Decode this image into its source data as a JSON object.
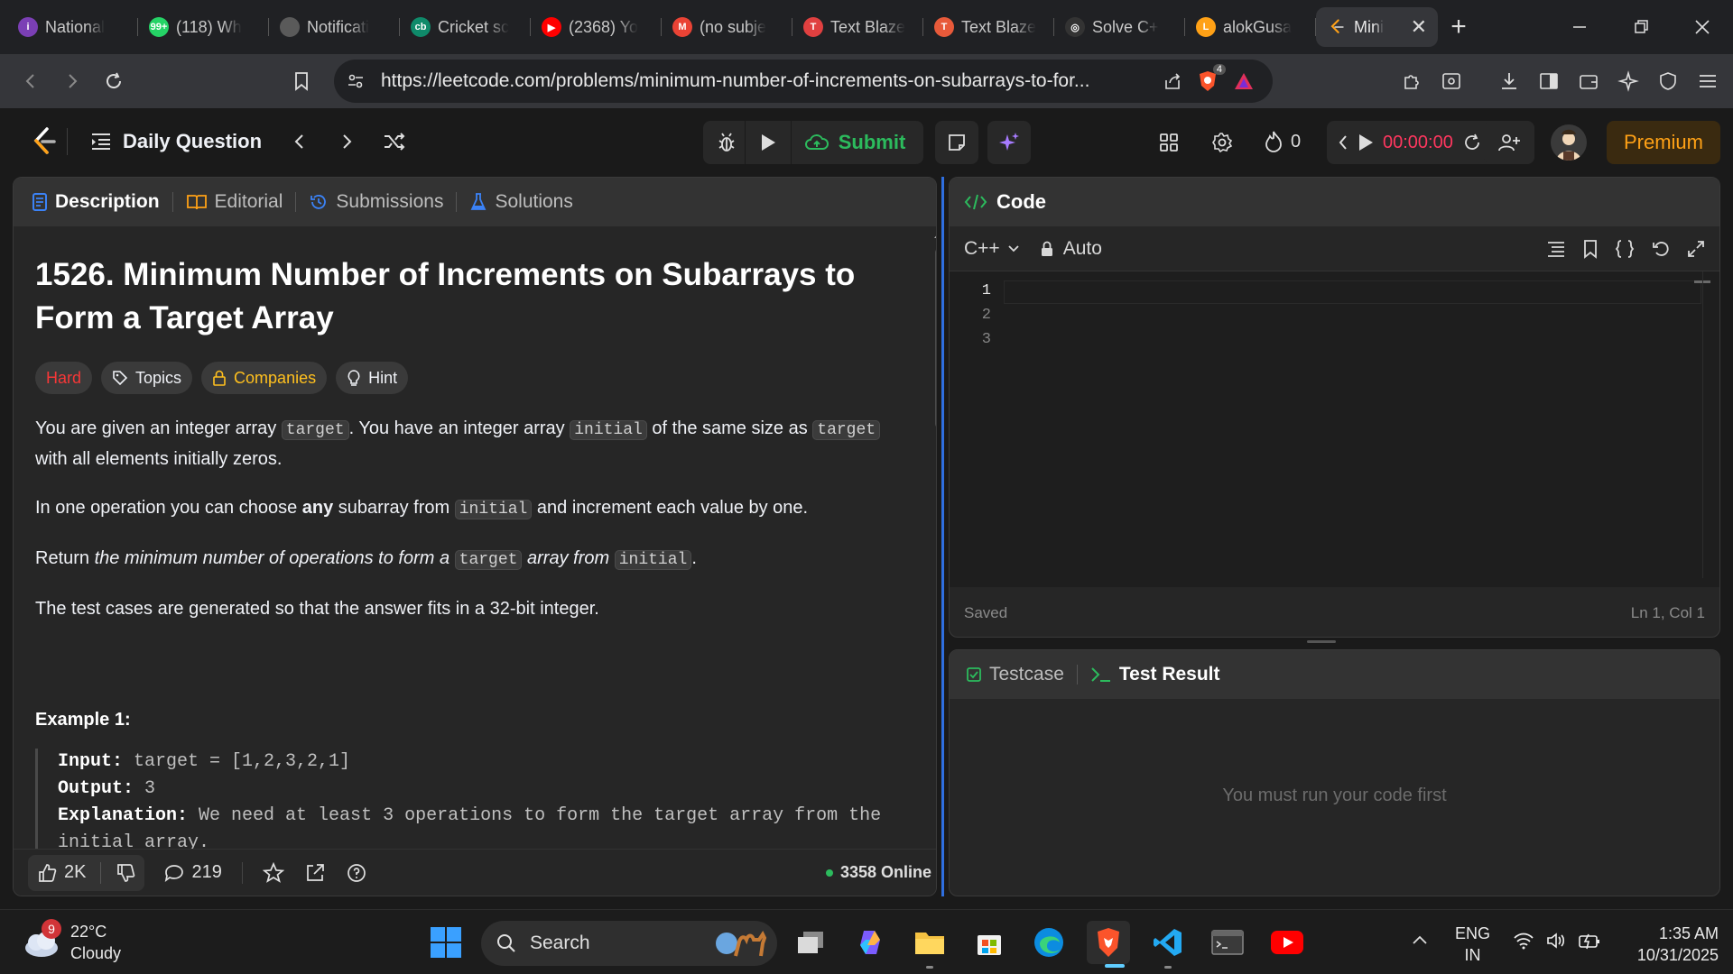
{
  "browser": {
    "tabs": [
      {
        "title": "National",
        "favicon_color": "#7b3fb5",
        "favicon_text": "i"
      },
      {
        "title": "(118) Wh",
        "favicon_color": "#25d366",
        "favicon_text": "99+"
      },
      {
        "title": "Notificati",
        "favicon_color": "#5a5a5a",
        "favicon_text": ""
      },
      {
        "title": "Cricket sc",
        "favicon_color": "#0f8a6a",
        "favicon_text": "cb"
      },
      {
        "title": "(2368) Yo",
        "favicon_color": "#ff0000",
        "favicon_text": "▶"
      },
      {
        "title": "(no subje",
        "favicon_color": "#ea4335",
        "favicon_text": "M"
      },
      {
        "title": "Text Blaze",
        "favicon_color": "#e04040",
        "favicon_text": "T"
      },
      {
        "title": "Text Blaze",
        "favicon_color": "#e85a3a",
        "favicon_text": "T"
      },
      {
        "title": "Solve C+",
        "favicon_color": "#333333",
        "favicon_text": "◎"
      },
      {
        "title": "alokGusa",
        "favicon_color": "#ffa116",
        "favicon_text": "L"
      }
    ],
    "active_tab": {
      "title": "Mini",
      "close": "✕"
    },
    "new_tab": "+",
    "url": "https://leetcode.com/problems/minimum-number-of-increments-on-subarrays-to-for...",
    "brave_badge": "4"
  },
  "header": {
    "daily_question": "Daily Question",
    "submit": "Submit",
    "streak": "0",
    "timer": "00:00:00",
    "premium": "Premium"
  },
  "description": {
    "tabs": {
      "description": "Description",
      "editorial": "Editorial",
      "submissions": "Submissions",
      "solutions": "Solutions"
    },
    "title": "1526. Minimum Number of Increments on Subarrays to Form a Target Array",
    "tags": {
      "difficulty": "Hard",
      "topics": "Topics",
      "companies": "Companies",
      "hint": "Hint"
    },
    "p1": {
      "a": "You are given an integer array ",
      "c1": "target",
      "b": ". You have an integer array ",
      "c2": "initial",
      "d": " of the same size as ",
      "c3": "target",
      "e": " with all elements initially zeros."
    },
    "p2": {
      "a": "In one operation you can choose ",
      "bold": "any",
      "b": " subarray from ",
      "c1": "initial",
      "c": " and increment each value by one."
    },
    "p3": {
      "a": "Return ",
      "i1": "the minimum number of operations to form a ",
      "c1": "target",
      "i2": " array from ",
      "c2": "initial",
      "e": "."
    },
    "p4": "The test cases are generated so that the answer fits in a 32-bit integer.",
    "example_heading": "Example 1:",
    "example": {
      "input_label": "Input:",
      "input_value": " target = [1,2,3,2,1]",
      "output_label": "Output:",
      "output_value": " 3",
      "explanation_label": "Explanation:",
      "explanation_value": " We need at least 3 operations to form the target array from the initial array."
    },
    "footer": {
      "likes": "2K",
      "comments": "219",
      "online": "3358 Online"
    }
  },
  "code": {
    "title": "Code",
    "language": "C++",
    "mode": "Auto",
    "line_numbers": [
      "1",
      "2",
      "3"
    ],
    "status": "Saved",
    "cursor": "Ln 1, Col 1"
  },
  "result": {
    "testcase_tab": "Testcase",
    "result_tab": "Test Result",
    "message": "You must run your code first"
  },
  "taskbar": {
    "weather_temp": "22°C",
    "weather_desc": "Cloudy",
    "weather_badge": "9",
    "search": "Search",
    "lang_top": "ENG",
    "lang_bottom": "IN",
    "time": "1:35 AM",
    "date": "10/31/2025"
  },
  "colors": {
    "accent": "#ffa116",
    "submit_green": "#2cbb5d",
    "hard_red": "#f63737",
    "online_dot": "#2cbb5d"
  }
}
